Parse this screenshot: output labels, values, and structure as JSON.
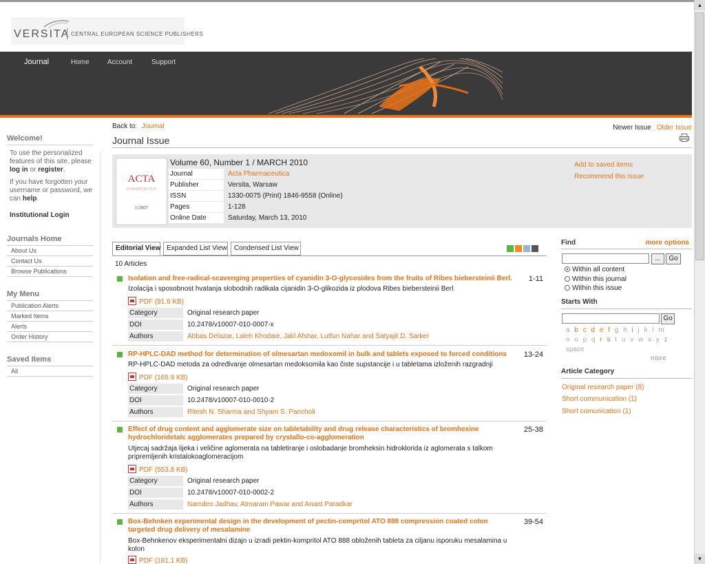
{
  "brand": {
    "name": "VERSITA",
    "tagline": "CENTRAL EUROPEAN SCIENCE PUBLISHERS"
  },
  "nav": [
    "Journal",
    "Home",
    "Account",
    "Support"
  ],
  "sidebar": {
    "welcome_title": "Welcome!",
    "welcome_p1a": "To use the personalized features of this site, please ",
    "login": "log in",
    "or": " or ",
    "register": "register",
    "period": ".",
    "welcome_p2a": "If you have forgotten your username or password, we can ",
    "help": "help",
    "institutional_login": "Institutional Login",
    "journals_home": {
      "title": "Journals Home",
      "items": [
        "About Us",
        "Contact Us",
        "Browse Publications"
      ]
    },
    "my_menu": {
      "title": "My Menu",
      "items": [
        "Publication Alerts",
        "Marked Items",
        "Alerts",
        "Order History"
      ]
    },
    "saved_items": {
      "title": "Saved Items",
      "items": [
        "All"
      ]
    }
  },
  "main": {
    "back_to_label": "Back to:",
    "back_to_link": "Journal",
    "newer_issue": "Newer Issue",
    "older_issue": "Older Issue",
    "page_title": "Journal Issue",
    "issue": {
      "volume": "Volume 60, Number 1 / MARCH 2010",
      "cover_title": "ACTA",
      "cover_sub": "PHARMACEUTICA",
      "cover_year": "1/2007",
      "rows": [
        {
          "k": "Journal",
          "v": "Acta Pharmaceutica",
          "link": true
        },
        {
          "k": "Publisher",
          "v": "Versita, Warsaw"
        },
        {
          "k": "ISSN",
          "v": "1330-0075 (Print) 1846-9558 (Online)"
        },
        {
          "k": "Pages",
          "v": "1-128"
        },
        {
          "k": "Online Date",
          "v": "Saturday, March 13, 2010"
        }
      ],
      "add_saved": "Add to saved items",
      "recommend": "Recommend this issue"
    },
    "tabs": [
      "Editorial View",
      "Expanded List View",
      "Condensed List View"
    ],
    "article_count": "10 Articles",
    "articles": [
      {
        "title": "Isolation and free-radical-scavenging properties of cyanidin 3-O-glycosides from the fruits of Ribes biebersteinii Berl.",
        "pages": "1-11",
        "translation": "Izolacija i sposobnost hvatanja slobodnih radikala cijanidin 3-O-glikozida iz plodova Ribes biebersteinii Berl",
        "pdf": "PDF (91.6 KB)",
        "category": "Original research paper",
        "doi": "10.2478/v10007-010-0007-x",
        "authors": "Abbas Delazar, Laleh Khodaie, Jalil Afshar, Lutfun Nahar and Satyajit D. Sarker"
      },
      {
        "title": "RP-HPLC-DAD method for determination of olmesartan medoxomil in bulk and tablets exposed to forced conditions",
        "pages": "13-24",
        "translation": "RP-HPLC-DAD metoda za određivanje olmesartan medoksomila kao čiste supstancije i u tabletama izloženih razgradnji",
        "pdf": "PDF (165.9 KB)",
        "category": "Original research paper",
        "doi": "10.2478/v10007-010-0010-2",
        "authors": "Ritesh N. Sharma and Shyam S. Pancholi"
      },
      {
        "title": "Effect of drug content and agglomerate size on tabletability and drug release characteristics of bromhexine hydrochloridetalc agglomerates prepared by crystallo-co-agglomeration",
        "pages": "25-38",
        "translation": "Utjecaj sadržaja lijeka i veličine aglomerata na tabletiranje i oslobadanje bromheksin hidroklorida iz aglomerata s talkom pripremljenih kristalokoaglomeracijom",
        "pdf": "PDF (553.8 KB)",
        "category": "Original research paper",
        "doi": "10.2478/v10007-010-0002-2",
        "authors": "Namdeo Jadhav, Atmaram Pawar and Anant Paradkar"
      },
      {
        "title": "Box-Behnken experimental design in the development of pectin-compritol ATO 888 compression coated colon targeted drug delivery of mesalamine",
        "pages": "39-54",
        "translation": "Box-Behnkenov eksperimentalni dizajn u izradi pektin-kompritol ATO 888 obloženih tableta za ciljanu isporuku mesalamina u kolon",
        "pdf": "PDF (181.1 KB)"
      }
    ],
    "meta_labels": {
      "category": "Category",
      "doi": "DOI",
      "authors": "Authors"
    }
  },
  "right": {
    "find": "Find",
    "more_options": "more options",
    "go": "Go",
    "browse_btn": "...",
    "scopes": [
      "Within all content",
      "Within this journal",
      "Within this issue"
    ],
    "starts_with": "Starts With",
    "alpha_row1": [
      "a",
      "b",
      "c",
      "d",
      "e",
      "f",
      "g",
      "h",
      "i",
      "j",
      "k",
      "l",
      "m"
    ],
    "alpha_row2": [
      "n",
      "o",
      "p",
      "q",
      "r",
      "s",
      "t",
      "u",
      "v",
      "w",
      "x",
      "y",
      "z"
    ],
    "space": "space",
    "more": "more",
    "article_category": "Article Category",
    "categories": [
      "Original research paper (8)",
      "Short communication (1)",
      "Short comunication (1)"
    ]
  },
  "colors": {
    "accent": "#e8731a",
    "banner": "#3a3a3a",
    "bullet": "#5cb33e"
  }
}
